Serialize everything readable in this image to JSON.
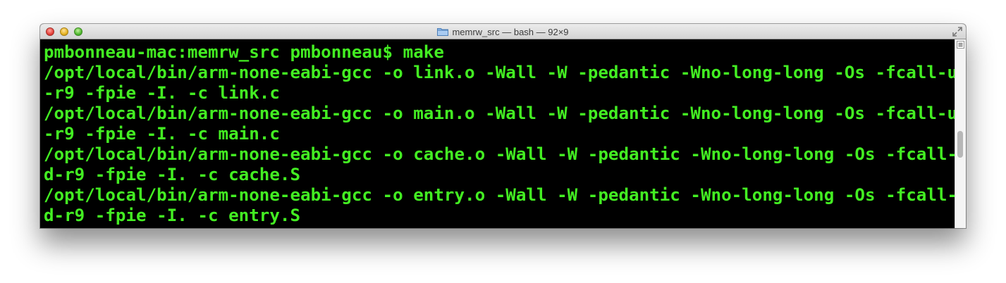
{
  "window": {
    "title": "memrw_src — bash — 92×9",
    "folder_icon": "folder-icon",
    "fullscreen_icon": "fullscreen-icon"
  },
  "terminal": {
    "lines": [
      "pmbonneau-mac:memrw_src pmbonneau$ make",
      "/opt/local/bin/arm-none-eabi-gcc -o link.o -Wall -W -pedantic -Wno-long-long -Os -fcall-used",
      "-r9 -fpie -I. -c link.c",
      "/opt/local/bin/arm-none-eabi-gcc -o main.o -Wall -W -pedantic -Wno-long-long -Os -fcall-used",
      "-r9 -fpie -I. -c main.c",
      "/opt/local/bin/arm-none-eabi-gcc -o cache.o -Wall -W -pedantic -Wno-long-long -Os -fcall-use",
      "d-r9 -fpie -I. -c cache.S",
      "/opt/local/bin/arm-none-eabi-gcc -o entry.o -Wall -W -pedantic -Wno-long-long -Os -fcall-use",
      "d-r9 -fpie -I. -c entry.S"
    ],
    "text_color": "#43ee22",
    "background_color": "#000000"
  },
  "scrollbar": {
    "menu_icon": "list-menu-icon"
  }
}
